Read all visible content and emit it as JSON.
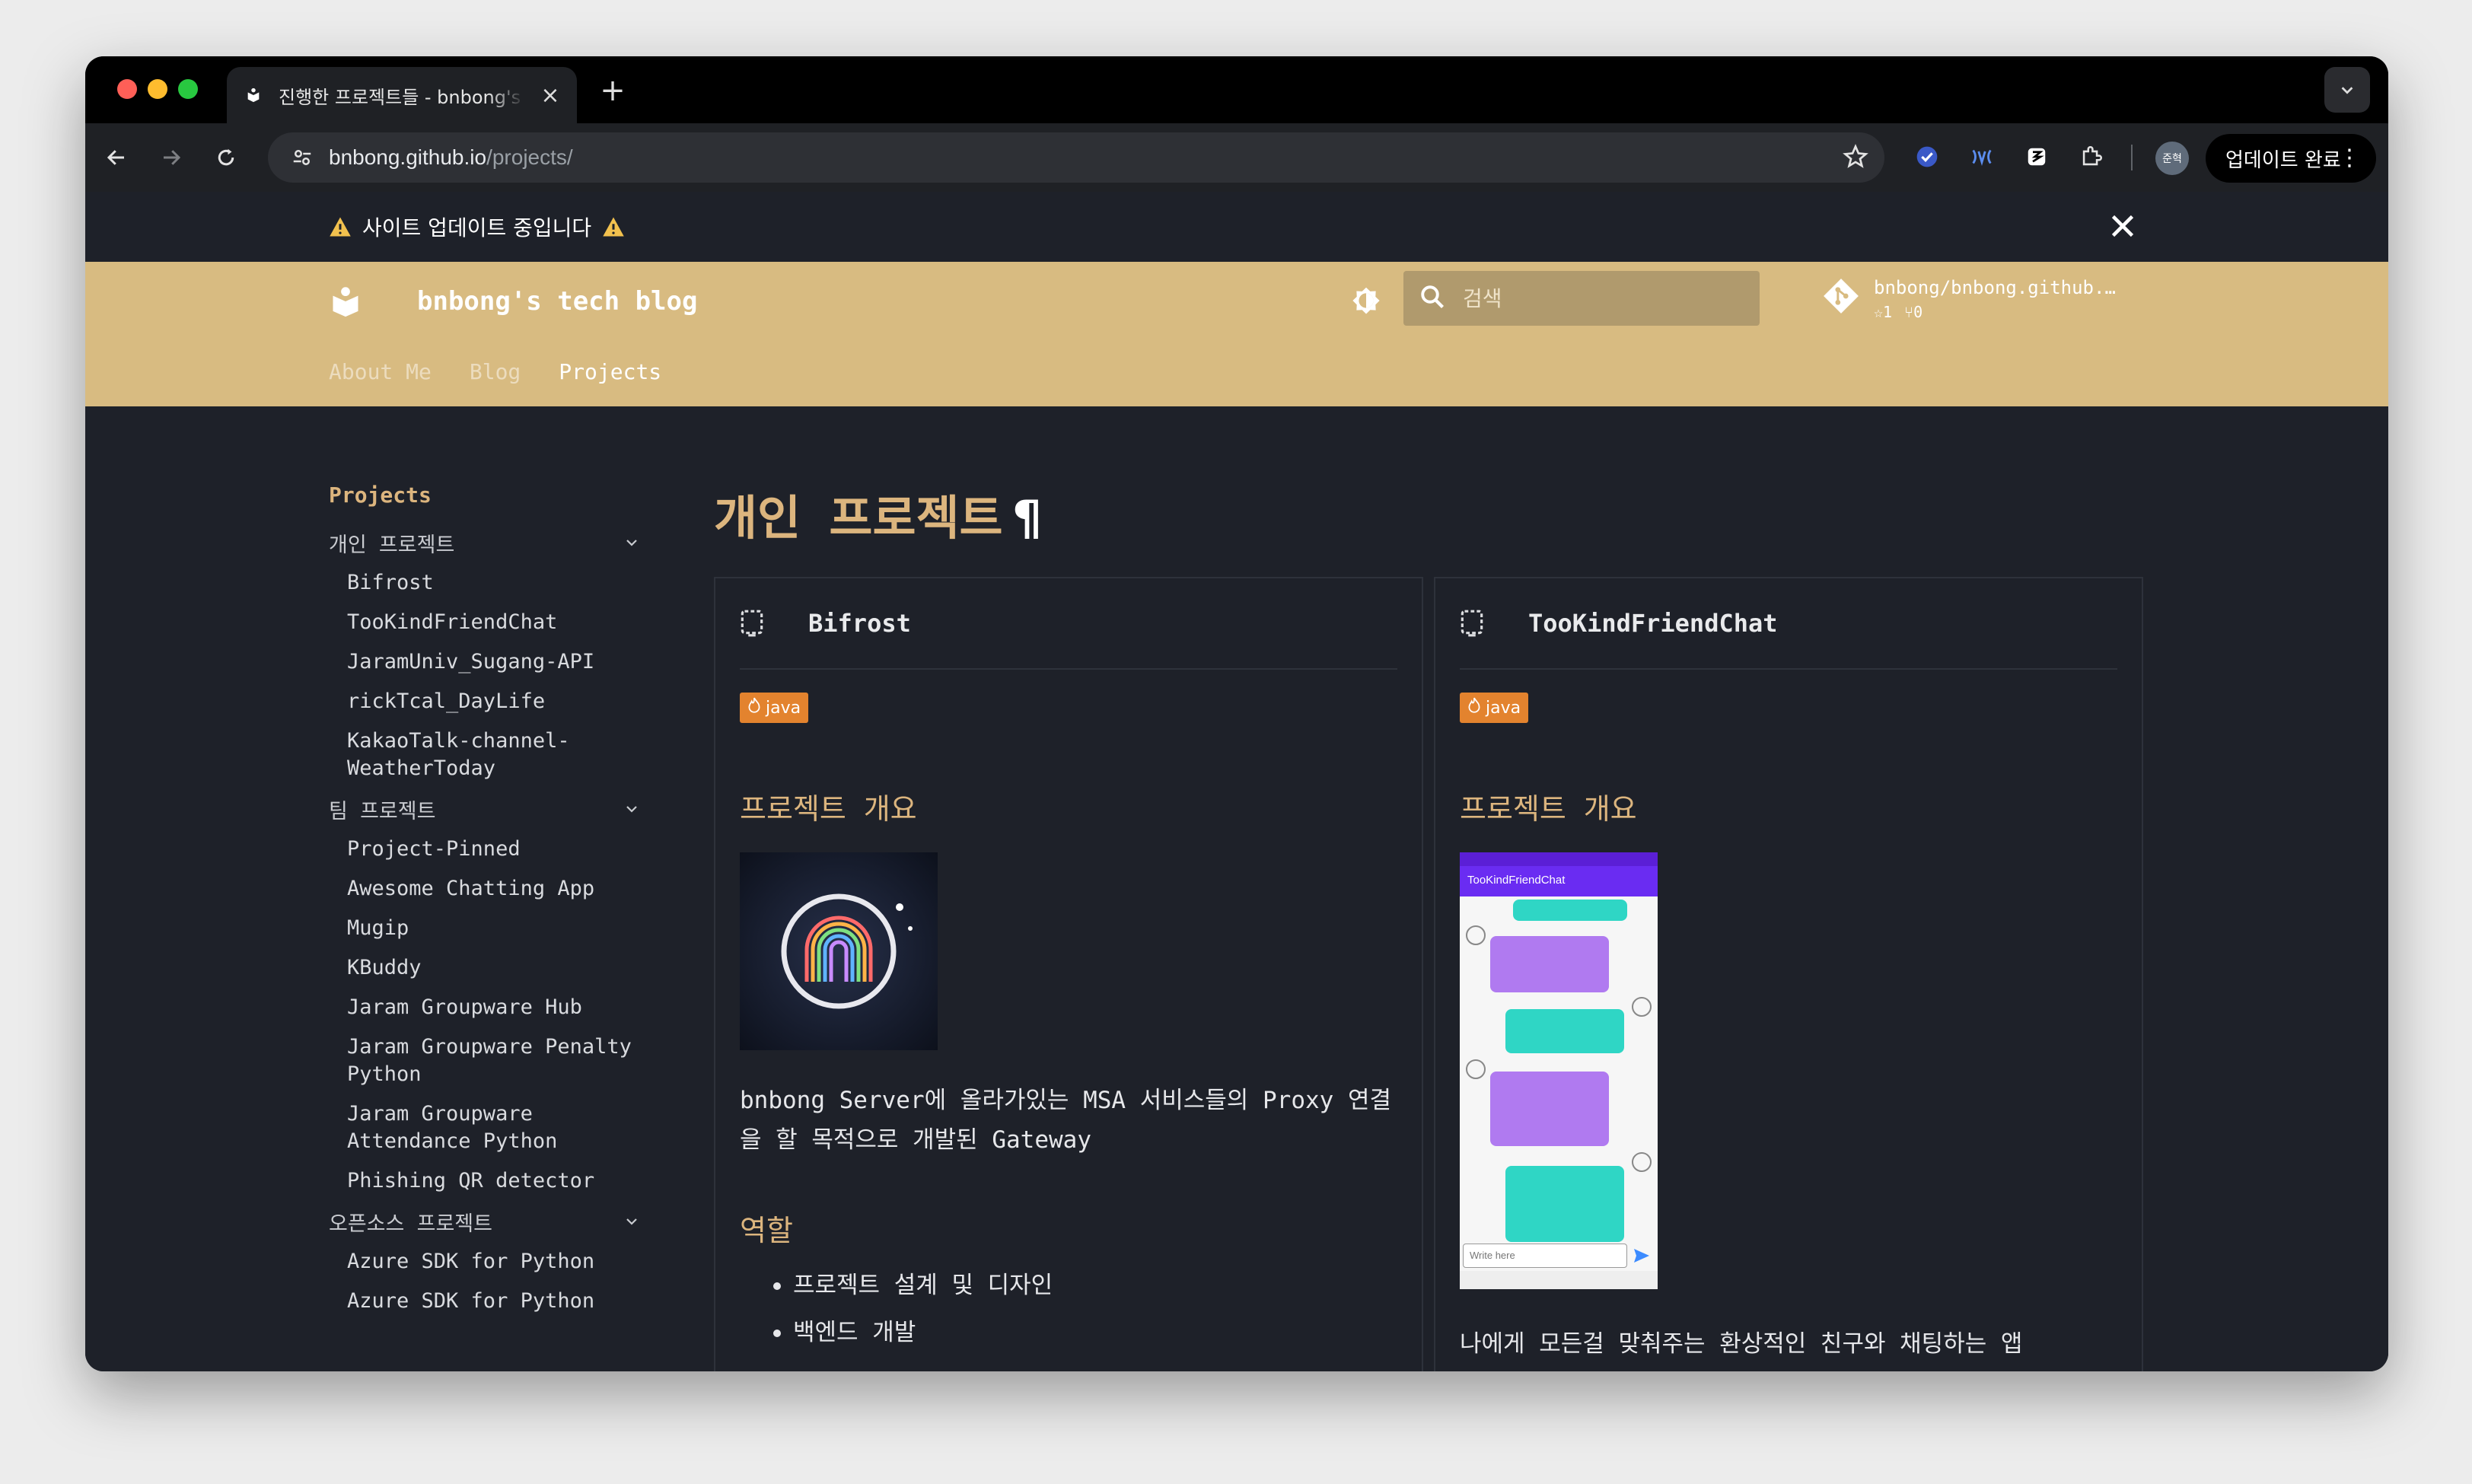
{
  "browser": {
    "tab_title": "진행한 프로젝트들 - bnbong's tech blog",
    "url_host": "bnbong.github.io",
    "url_path": "/projects/",
    "profile_label": "준혁",
    "update_button": "업데이트 완료"
  },
  "announcement": {
    "text": "사이트 업데이트 중입니다"
  },
  "header": {
    "site_title": "bnbong's tech blog",
    "search_placeholder": "검색",
    "repo_name": "bnbong/bnbong.github.io",
    "repo_stars": "1",
    "repo_forks": "0",
    "nav": [
      "About Me",
      "Blog",
      "Projects"
    ]
  },
  "sidebar": {
    "heading": "Projects",
    "sections": [
      {
        "label": "개인 프로젝트",
        "items": [
          "Bifrost",
          "TooKindFriendChat",
          "JaramUniv_Sugang-API",
          "rickTcal_DayLife",
          "KakaoTalk-channel-WeatherToday"
        ]
      },
      {
        "label": "팀 프로젝트",
        "items": [
          "Project-Pinned",
          "Awesome Chatting App",
          "Mugip",
          "KBuddy",
          "Jaram Groupware Hub",
          "Jaram Groupware Penalty Python",
          "Jaram Groupware Attendance Python",
          "Phishing QR detector"
        ]
      },
      {
        "label": "오픈소스 프로젝트",
        "items": [
          "Azure SDK for Python",
          "Azure SDK for Python"
        ]
      }
    ]
  },
  "main": {
    "page_title": "개인 프로젝트",
    "pilcrow": "¶",
    "cards": [
      {
        "title": "Bifrost",
        "tag": "java",
        "overview_heading": "프로젝트 개요",
        "description": "bnbong Server에 올라가있는 MSA 서비스들의 Proxy 연결을 할 목적으로 개발된 Gateway",
        "role_heading": "역할",
        "roles": [
          "프로젝트 설계 및 디자인",
          "백엔드 개발"
        ]
      },
      {
        "title": "TooKindFriendChat",
        "tag": "java",
        "overview_heading": "프로젝트 개요",
        "description": "나에게 모든걸 맞춰주는 환상적인 친구와 채팅하는 앱",
        "phone_app_title": "TooKindFriendChat",
        "phone_input_placeholder": "Write here"
      }
    ]
  },
  "colors": {
    "header_bg": "#d8bb81",
    "accent": "#dcb57e",
    "tag": "#e3832e",
    "content_bg": "#1e2129"
  }
}
